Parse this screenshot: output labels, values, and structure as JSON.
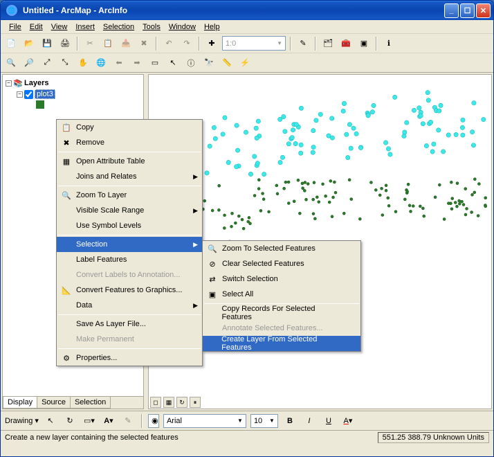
{
  "titlebar": {
    "title": "Untitled - ArcMap - ArcInfo"
  },
  "menubar": [
    "File",
    "Edit",
    "View",
    "Insert",
    "Selection",
    "Tools",
    "Window",
    "Help"
  ],
  "scale_combo": "1:0",
  "toc": {
    "root": "Layers",
    "layer": {
      "name": "plot3",
      "checked": true
    }
  },
  "toc_tabs": [
    "Display",
    "Source",
    "Selection"
  ],
  "ctx1": {
    "items": [
      {
        "label": "Copy",
        "icon": "copy"
      },
      {
        "label": "Remove",
        "icon": "remove"
      },
      {
        "label": "Open Attribute Table",
        "icon": "table",
        "sep": true
      },
      {
        "label": "Joins and Relates",
        "sub": true
      },
      {
        "label": "Zoom To Layer",
        "icon": "zoom-layer",
        "sep": true
      },
      {
        "label": "Visible Scale Range",
        "sub": true
      },
      {
        "label": "Use Symbol Levels"
      },
      {
        "label": "Selection",
        "sub": true,
        "hl": true,
        "sep": true
      },
      {
        "label": "Label Features"
      },
      {
        "label": "Convert Labels to Annotation...",
        "dis": true
      },
      {
        "label": "Convert Features to Graphics...",
        "icon": "convert"
      },
      {
        "label": "Data",
        "sub": true,
        "sep": true
      },
      {
        "label": "Save As Layer File..."
      },
      {
        "label": "Make Permanent",
        "dis": true
      },
      {
        "label": "Properties...",
        "icon": "props",
        "sep": true
      }
    ]
  },
  "ctx2": {
    "items": [
      {
        "label": "Zoom To Selected Features",
        "icon": "zoom-sel"
      },
      {
        "label": "Clear Selected Features",
        "icon": "clear-sel"
      },
      {
        "label": "Switch Selection",
        "icon": "switch"
      },
      {
        "label": "Select All",
        "icon": "select-all"
      },
      {
        "label": "Copy Records For Selected Features",
        "sep": true
      },
      {
        "label": "Annotate Selected Features...",
        "dis": true
      },
      {
        "label": "Create Layer From Selected Features",
        "hl": true
      }
    ]
  },
  "drawing": {
    "label": "Drawing",
    "font": "Arial",
    "size": "10"
  },
  "status": {
    "hint": "Create a new layer containing the selected features",
    "coords": "551.25 388.79 Unknown Units"
  },
  "chart_data": {
    "type": "scatter",
    "title": "",
    "series": [
      {
        "name": "selected (cyan)",
        "count_approx": 95
      },
      {
        "name": "unselected (green)",
        "count_approx": 120
      }
    ],
    "note": "Point-feature layer displayed in map view; cyan points are selected, dark green points are unselected."
  }
}
